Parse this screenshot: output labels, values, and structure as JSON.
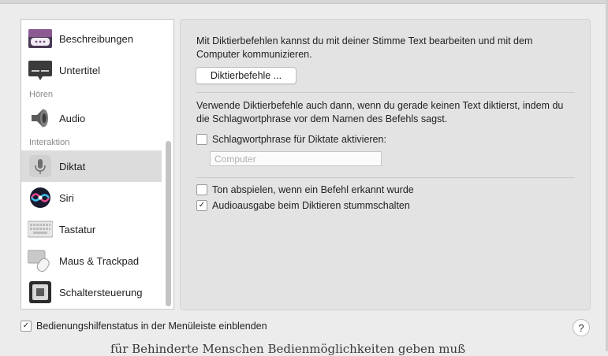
{
  "sidebar": {
    "items_top": [
      {
        "label": "Beschreibungen",
        "icon": "speech-bubbles-icon"
      },
      {
        "label": "Untertitel",
        "icon": "captions-icon"
      }
    ],
    "section_hoeren": "Hören",
    "item_audio": {
      "label": "Audio",
      "icon": "speaker-icon"
    },
    "section_interaktion": "Interaktion",
    "items_interaktion": [
      {
        "label": "Diktat",
        "icon": "microphone-icon",
        "selected": true
      },
      {
        "label": "Siri",
        "icon": "siri-icon"
      },
      {
        "label": "Tastatur",
        "icon": "keyboard-icon"
      },
      {
        "label": "Maus & Trackpad",
        "icon": "mouse-trackpad-icon"
      },
      {
        "label": "Schaltersteuerung",
        "icon": "switch-control-icon"
      }
    ]
  },
  "panel": {
    "intro_text": "Mit Diktierbefehlen kannst du mit deiner Stimme Text bearbeiten und mit dem Computer kommunizieren.",
    "commands_button": "Diktierbefehle ...",
    "keyword_text": "Verwende Diktierbefehle auch dann, wenn du gerade keinen Text diktierst, indem du die Schlagwortphrase vor dem Namen des Befehls sagst.",
    "keyword_checkbox": {
      "label": "Schlagwortphrase für Diktate aktivieren:",
      "checked": false
    },
    "keyword_field_placeholder": "Computer",
    "sound_checkbox": {
      "label": "Ton abspielen, wenn ein Befehl erkannt wurde",
      "checked": false
    },
    "mute_checkbox": {
      "label": "Audioausgabe beim Diktieren stummschalten",
      "checked": true
    }
  },
  "footer": {
    "menubar_checkbox": {
      "label": "Bedienungshilfenstatus in der Menüleiste einblenden",
      "checked": true
    },
    "help_label": "?"
  },
  "background_text": "für Behinderte Menschen Bedienmöglichkeiten geben muß"
}
